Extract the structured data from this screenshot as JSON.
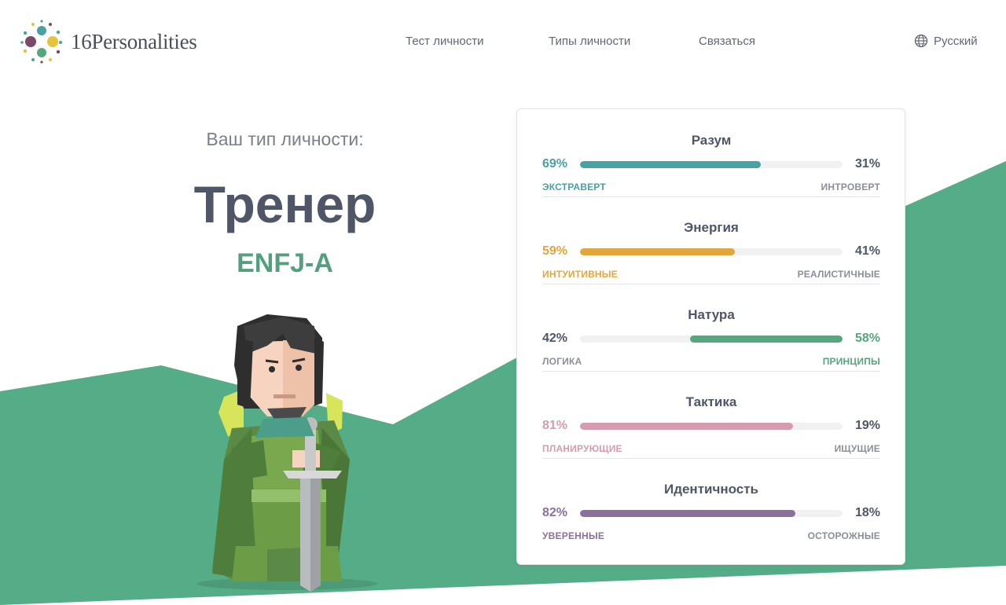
{
  "header": {
    "logo_text": "16Personalities",
    "nav": [
      {
        "label": "Тест личности"
      },
      {
        "label": "Типы личности"
      },
      {
        "label": "Связаться"
      }
    ],
    "language": "Русский"
  },
  "hero": {
    "label": "Ваш тип личности:",
    "type_name": "Тренер",
    "type_code": "ENFJ-A"
  },
  "traits": [
    {
      "title": "Разум",
      "left_pct": "69%",
      "right_pct": "31%",
      "left_label": "ЭКСТРАВЕРТ",
      "right_label": "ИНТРОВЕРТ",
      "dominant": "left",
      "fill_fraction": 0.69,
      "color": "#4aa1a3"
    },
    {
      "title": "Энергия",
      "left_pct": "59%",
      "right_pct": "41%",
      "left_label": "ИНТУИТИВНЫЕ",
      "right_label": "РЕАЛИСТИЧНЫЕ",
      "dominant": "left",
      "fill_fraction": 0.59,
      "color": "#e2a63e"
    },
    {
      "title": "Натура",
      "left_pct": "42%",
      "right_pct": "58%",
      "left_label": "ЛОГИКА",
      "right_label": "ПРИНЦИПЫ",
      "dominant": "right",
      "fill_fraction": 0.58,
      "color": "#55a77f"
    },
    {
      "title": "Тактика",
      "left_pct": "81%",
      "right_pct": "19%",
      "left_label": "ПЛАНИРУЮЩИЕ",
      "right_label": "ИЩУЩИЕ",
      "dominant": "left",
      "fill_fraction": 0.81,
      "color": "#d59bb1"
    },
    {
      "title": "Идентичность",
      "left_pct": "82%",
      "right_pct": "18%",
      "left_label": "УВЕРЕННЫЕ",
      "right_label": "ОСТОРОЖНЫЕ",
      "dominant": "left",
      "fill_fraction": 0.82,
      "color": "#8b6f9c"
    }
  ],
  "colors": {
    "accent_green": "#55ad87",
    "text_dark": "#4e5667"
  }
}
